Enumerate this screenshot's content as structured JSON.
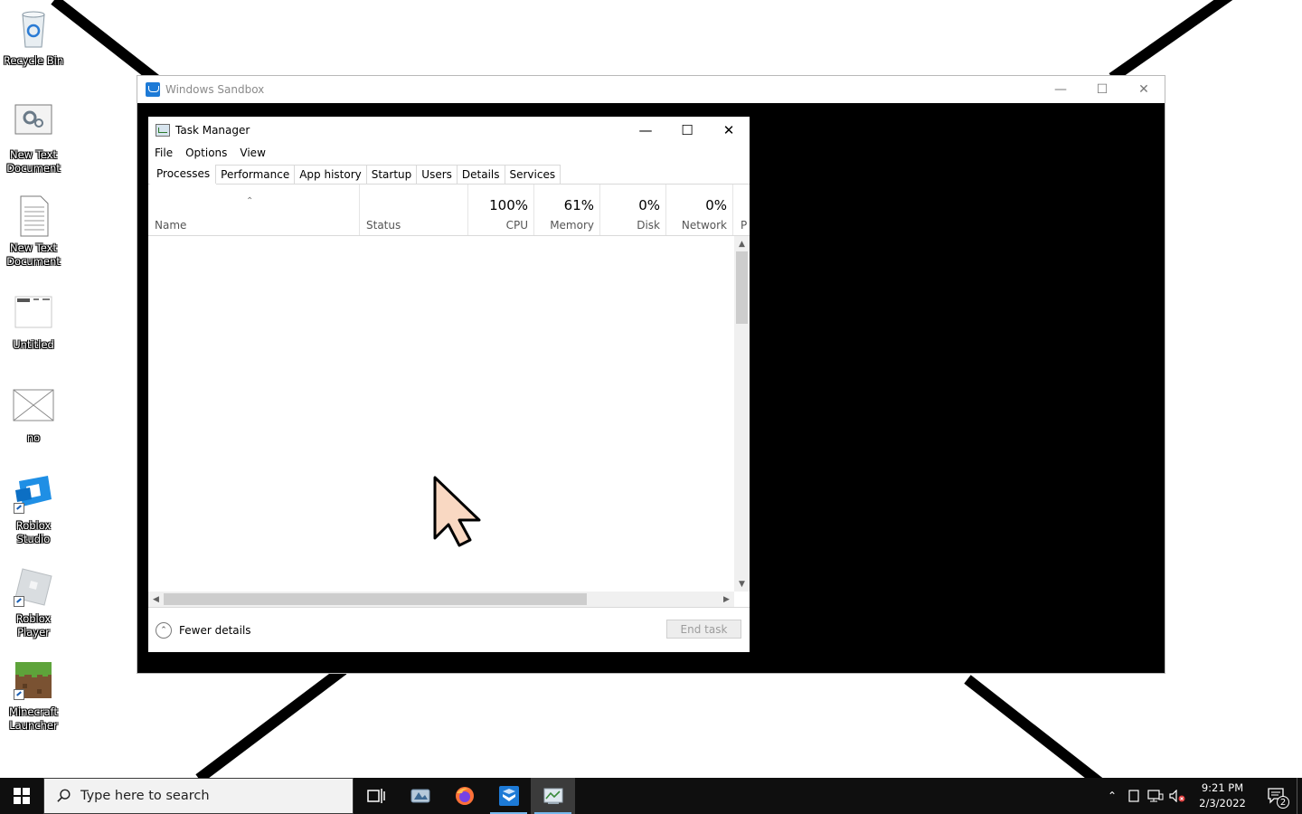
{
  "desktop": {
    "icons": [
      {
        "label": "Recycle Bin",
        "icon": "recycle-bin-icon"
      },
      {
        "label": "New Text\nDocument",
        "icon": "settings-document-icon"
      },
      {
        "label": "New Text\nDocument",
        "icon": "text-document-icon"
      },
      {
        "label": "Untitled",
        "icon": "image-file-icon"
      },
      {
        "label": "no",
        "icon": "envelope-icon"
      },
      {
        "label": "Roblox\nStudio",
        "icon": "roblox-studio-icon"
      },
      {
        "label": "Roblox\nPlayer",
        "icon": "roblox-player-icon"
      },
      {
        "label": "Minecraft\nLauncher",
        "icon": "minecraft-icon"
      }
    ]
  },
  "sandbox": {
    "title": "Windows Sandbox",
    "controls": {
      "minimize": "minimize-icon",
      "maximize": "maximize-icon",
      "close": "close-icon"
    }
  },
  "task_manager": {
    "title": "Task Manager",
    "menu": [
      "File",
      "Options",
      "View"
    ],
    "tabs": [
      "Processes",
      "Performance",
      "App history",
      "Startup",
      "Users",
      "Details",
      "Services"
    ],
    "active_tab": "Processes",
    "columns": {
      "name": "Name",
      "status": "Status",
      "cpu": {
        "pct": "100%",
        "label": "CPU"
      },
      "memory": {
        "pct": "61%",
        "label": "Memory"
      },
      "disk": {
        "pct": "0%",
        "label": "Disk"
      },
      "network": {
        "pct": "0%",
        "label": "Network"
      },
      "overflow": "P"
    },
    "fewer_details": "Fewer details",
    "end_task": "End task"
  },
  "taskbar": {
    "search_placeholder": "Type here to search",
    "pinned": [
      "task-view-icon",
      "app-icon",
      "firefox-icon",
      "windows-sandbox-icon",
      "task-manager-icon"
    ],
    "tray": [
      "chevron-up-icon",
      "tablet-icon",
      "network-icon",
      "volume-muted-icon"
    ],
    "time": "9:21 PM",
    "date": "2/3/2022",
    "notifications": "2"
  },
  "colors": {
    "taskbar": "#0f0f0f",
    "accent": "#1d7ad6",
    "sandbox_bg": "#000000"
  }
}
